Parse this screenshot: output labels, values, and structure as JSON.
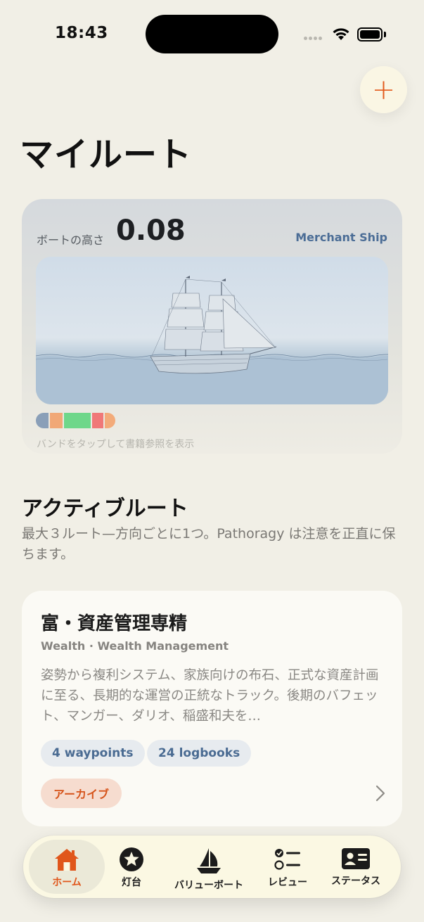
{
  "status_bar": {
    "time": "18:43"
  },
  "header": {
    "title": "マイルート",
    "add_label": "+"
  },
  "boat_card": {
    "height_label": "ボートの高さ",
    "height_value": "0.08",
    "ship_type": "Merchant Ship",
    "band_hint": "バンドをタップして書籍参照を表示",
    "band_colors": [
      "#8a9fb8",
      "#f1a877",
      "#6fd78a",
      "#f07878",
      "#f3ab7a"
    ]
  },
  "active_routes": {
    "title": "アクティブルート",
    "description": "最大３ルート—方向ごとに1つ。Pathoragy は注意を正直に保ちます。"
  },
  "route": {
    "title": "富・資産管理専精",
    "subtitle": "Wealth · Wealth Management",
    "description": "姿勢から複利システム、家族向けの布石、正式な資産計画に至る、長期的な運営の正統なトラック。後期のバフェット、マンガー、ダリオ、稲盛和夫を…",
    "waypoints": "4 waypoints",
    "logbooks": "24 logbooks",
    "archive_label": "アーカイブ"
  },
  "tab_bar": {
    "tabs": [
      {
        "label": "ホーム",
        "icon": "home-icon",
        "active": true
      },
      {
        "label": "灯台",
        "icon": "star-circle-icon",
        "active": false
      },
      {
        "label": "バリューボート",
        "icon": "sailboat-icon",
        "active": false
      },
      {
        "label": "レビュー",
        "icon": "checklist-icon",
        "active": false
      },
      {
        "label": "ステータス",
        "icon": "id-card-icon",
        "active": false
      }
    ]
  },
  "colors": {
    "accent": "#e35a1c",
    "link": "#4b6d96",
    "background": "#f1efe6"
  }
}
